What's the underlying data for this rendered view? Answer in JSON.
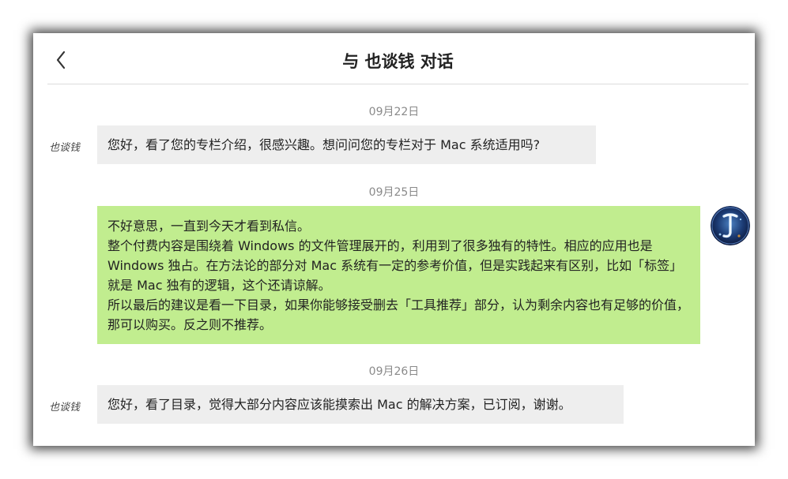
{
  "header": {
    "title": "与 也谈钱 对话",
    "back_icon": "chevron-left-icon"
  },
  "messages": [
    {
      "date": "09月22日",
      "sender": "也谈钱",
      "direction": "incoming",
      "text": "您好，看了您的专栏介绍，很感兴趣。想问问您的专栏对于 Mac 系统适用吗?"
    },
    {
      "date": "09月25日",
      "direction": "outgoing",
      "avatar_icon": "user-avatar-icon",
      "lines": [
        "不好意思，一直到今天才看到私信。",
        "整个付费内容是围绕着 Windows 的文件管理展开的，利用到了很多独有的特性。相应的应用也是 Windows 独占。在方法论的部分对 Mac 系统有一定的参考价值，但是实践起来有区别，比如「标签」就是 Mac 独有的逻辑，这个还请谅解。",
        "所以最后的建议是看一下目录，如果你能够接受删去「工具推荐」部分，认为剩余内容也有足够的价值，那可以购买。反之则不推荐。"
      ]
    },
    {
      "date": "09月26日",
      "sender": "也谈钱",
      "direction": "incoming",
      "text": "您好，看了目录，觉得大部分内容应该能摸索出 Mac 的解决方案，已订阅，谢谢。"
    }
  ],
  "colors": {
    "incoming_bubble": "#eeeeee",
    "outgoing_bubble": "#c1ed8f",
    "date_text": "#8a8a8a",
    "divider": "#dcdcdc"
  }
}
